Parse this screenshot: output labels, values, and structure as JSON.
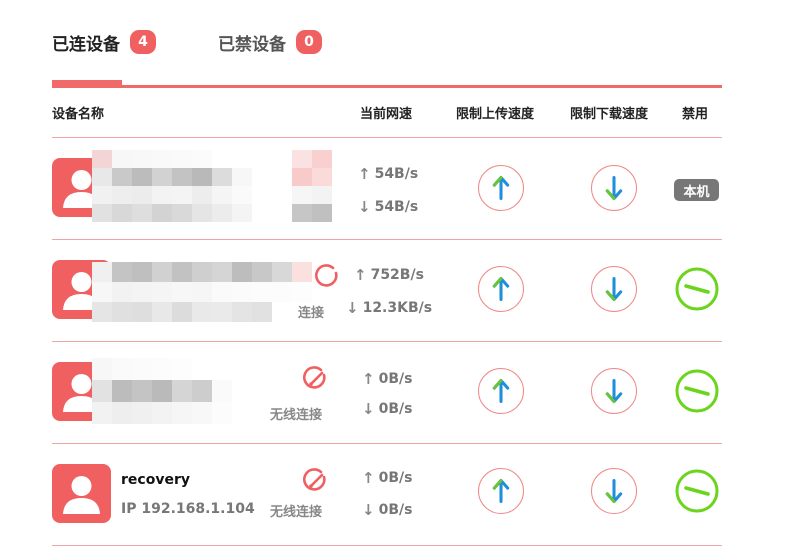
{
  "tabs": [
    {
      "label": "已连设备",
      "count": "4"
    },
    {
      "label": "已禁设备",
      "count": "0"
    }
  ],
  "columns": {
    "name": "设备名称",
    "speed": "当前网速",
    "limit_up": "限制上传速度",
    "limit_down": "限制下载速度",
    "ban": "禁用"
  },
  "devices": [
    {
      "name": "",
      "ip": "",
      "connection": "",
      "up_speed": "54B/s",
      "down_speed": "54B/s",
      "local_label": "本机"
    },
    {
      "name": "",
      "ip": "",
      "connection": "连接",
      "up_speed": "752B/s",
      "down_speed": "12.3KB/s"
    },
    {
      "name": "",
      "ip": "",
      "connection": "无线连接",
      "up_speed": "0B/s",
      "down_speed": "0B/s"
    },
    {
      "name": "recovery",
      "ip": "IP 192.168.1.104",
      "connection": "无线连接",
      "up_speed": "0B/s",
      "down_speed": "0B/s"
    }
  ],
  "icons": {
    "avatar": "user-avatar-icon",
    "connection": "wireless-connection-icon",
    "upload": "upload-arrow-icon",
    "download": "download-arrow-icon",
    "ban": "ban-toggle-icon"
  },
  "colors": {
    "accent": "#f06060",
    "up_arrow": "#1e8fd8",
    "down_arrow": "#1e8fd8",
    "arrow_accent": "#6ac43a",
    "ban": "#6bd41c",
    "divider": "#f2a5a5"
  }
}
